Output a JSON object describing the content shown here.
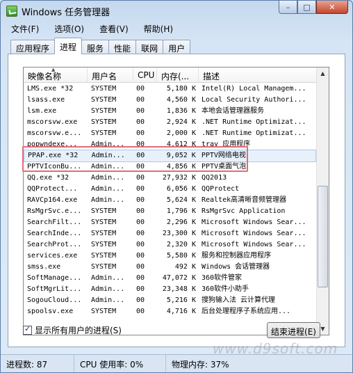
{
  "window": {
    "title": "Windows 任务管理器"
  },
  "window_buttons": {
    "minimize": "–",
    "maximize": "□",
    "close": "✕"
  },
  "menu": [
    "文件(F)",
    "选项(O)",
    "查看(V)",
    "帮助(H)"
  ],
  "tabs": [
    "应用程序",
    "进程",
    "服务",
    "性能",
    "联网",
    "用户"
  ],
  "active_tab": "进程",
  "columns": [
    "映像名称",
    "用户名",
    "CPU",
    "内存(...",
    "描述"
  ],
  "processes": [
    {
      "name": "LMS.exe *32",
      "user": "SYSTEM",
      "cpu": "00",
      "mem": "5,180 K",
      "desc": "Intel(R) Local Managem..."
    },
    {
      "name": "lsass.exe",
      "user": "SYSTEM",
      "cpu": "00",
      "mem": "4,560 K",
      "desc": "Local Security Authori..."
    },
    {
      "name": "lsm.exe",
      "user": "SYSTEM",
      "cpu": "00",
      "mem": "1,836 K",
      "desc": "本地会话管理器服务"
    },
    {
      "name": "mscorsvw.exe",
      "user": "SYSTEM",
      "cpu": "00",
      "mem": "2,924 K",
      "desc": ".NET Runtime Optimizat..."
    },
    {
      "name": "mscorsvw.e...",
      "user": "SYSTEM",
      "cpu": "00",
      "mem": "2,000 K",
      "desc": ".NET Runtime Optimizat..."
    },
    {
      "name": "popwndexe...",
      "user": "Admin...",
      "cpu": "00",
      "mem": "4,612 K",
      "desc": "tray 应用程序"
    },
    {
      "name": "PPAP.exe *32",
      "user": "Admin...",
      "cpu": "00",
      "mem": "9,052 K",
      "desc": "PPTV网络电视"
    },
    {
      "name": "PPTVIconBu...",
      "user": "Admin...",
      "cpu": "00",
      "mem": "4,856 K",
      "desc": "PPTV桌面气泡"
    },
    {
      "name": "QQ.exe *32",
      "user": "Admin...",
      "cpu": "00",
      "mem": "27,932 K",
      "desc": "QQ2013"
    },
    {
      "name": "QQProtect...",
      "user": "Admin...",
      "cpu": "00",
      "mem": "6,056 K",
      "desc": "QQProtect"
    },
    {
      "name": "RAVCp164.exe",
      "user": "Admin...",
      "cpu": "00",
      "mem": "5,624 K",
      "desc": "Realtek高清晰音频管理器"
    },
    {
      "name": "RsMgrSvc.e...",
      "user": "SYSTEM",
      "cpu": "00",
      "mem": "1,796 K",
      "desc": "RsMgrSvc Application"
    },
    {
      "name": "SearchFilt...",
      "user": "SYSTEM",
      "cpu": "00",
      "mem": "2,296 K",
      "desc": "Microsoft Windows Sear..."
    },
    {
      "name": "SearchInde...",
      "user": "SYSTEM",
      "cpu": "00",
      "mem": "23,300 K",
      "desc": "Microsoft Windows Sear..."
    },
    {
      "name": "SearchProt...",
      "user": "SYSTEM",
      "cpu": "00",
      "mem": "2,320 K",
      "desc": "Microsoft Windows Sear..."
    },
    {
      "name": "services.exe",
      "user": "SYSTEM",
      "cpu": "00",
      "mem": "5,580 K",
      "desc": "服务和控制器应用程序"
    },
    {
      "name": "smss.exe",
      "user": "SYSTEM",
      "cpu": "00",
      "mem": "492 K",
      "desc": "Windows 会话管理器"
    },
    {
      "name": "SoftManage...",
      "user": "Admin...",
      "cpu": "00",
      "mem": "47,072 K",
      "desc": "360软件管家"
    },
    {
      "name": "SoftMgrLit...",
      "user": "Admin...",
      "cpu": "00",
      "mem": "23,348 K",
      "desc": "360软件小助手"
    },
    {
      "name": "SogouCloud...",
      "user": "Admin...",
      "cpu": "00",
      "mem": "5,216 K",
      "desc": "搜狗输入法 云计算代理"
    },
    {
      "name": "spoolsv.exe",
      "user": "SYSTEM",
      "cpu": "00",
      "mem": "4,716 K",
      "desc": "后台处理程序子系统应用..."
    }
  ],
  "show_all_users": {
    "label": "显示所有用户的进程(S)",
    "checked": true
  },
  "end_process_button": "结束进程(E)",
  "watermark": "www.d9soft.com",
  "status": {
    "processes": "进程数: 87",
    "cpu": "CPU 使用率: 0%",
    "memory": "物理内存: 37%"
  }
}
